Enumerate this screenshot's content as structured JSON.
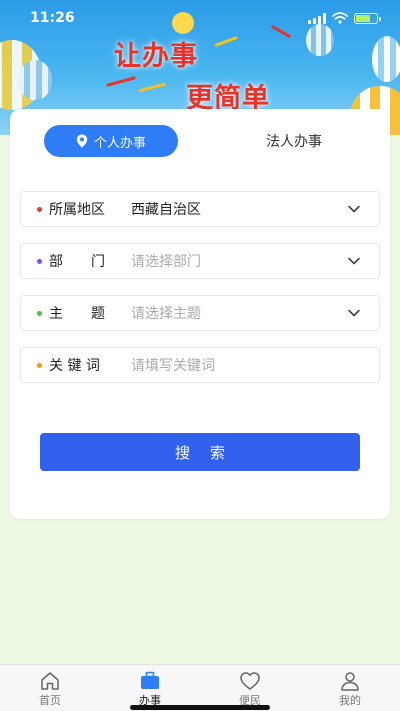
{
  "status_bar": {
    "time": "11:26"
  },
  "banner": {
    "line1": "让办事",
    "line2": "更简单"
  },
  "tabs": [
    {
      "label": "个人办事",
      "icon": "location-pin-icon",
      "active": true
    },
    {
      "label": "法人办事",
      "active": false
    }
  ],
  "form": {
    "fields": [
      {
        "label": "所属地区",
        "value": "西藏自治区",
        "placeholder": "",
        "dot_color": "#e53935",
        "has_dropdown": true
      },
      {
        "label": "部　　门",
        "value": "",
        "placeholder": "请选择部门",
        "dot_color": "#7c4dff",
        "has_dropdown": true
      },
      {
        "label": "主　　题",
        "value": "",
        "placeholder": "请选择主题",
        "dot_color": "#43c443",
        "has_dropdown": true
      },
      {
        "label": "关 键 词",
        "value": "",
        "placeholder": "请填写关键词",
        "dot_color": "#ff9800",
        "has_dropdown": false
      }
    ],
    "search_label": "搜索"
  },
  "bottom_nav": [
    {
      "label": "首页",
      "icon": "home-icon",
      "active": false
    },
    {
      "label": "办事",
      "icon": "briefcase-icon",
      "active": true
    },
    {
      "label": "便民",
      "icon": "heart-icon",
      "active": false
    },
    {
      "label": "我的",
      "icon": "user-icon",
      "active": false
    }
  ],
  "colors": {
    "accent": "#2e7cf6",
    "search_button": "#3361ee",
    "page_background": "#eef9e4",
    "slogan": "#e8332a"
  }
}
